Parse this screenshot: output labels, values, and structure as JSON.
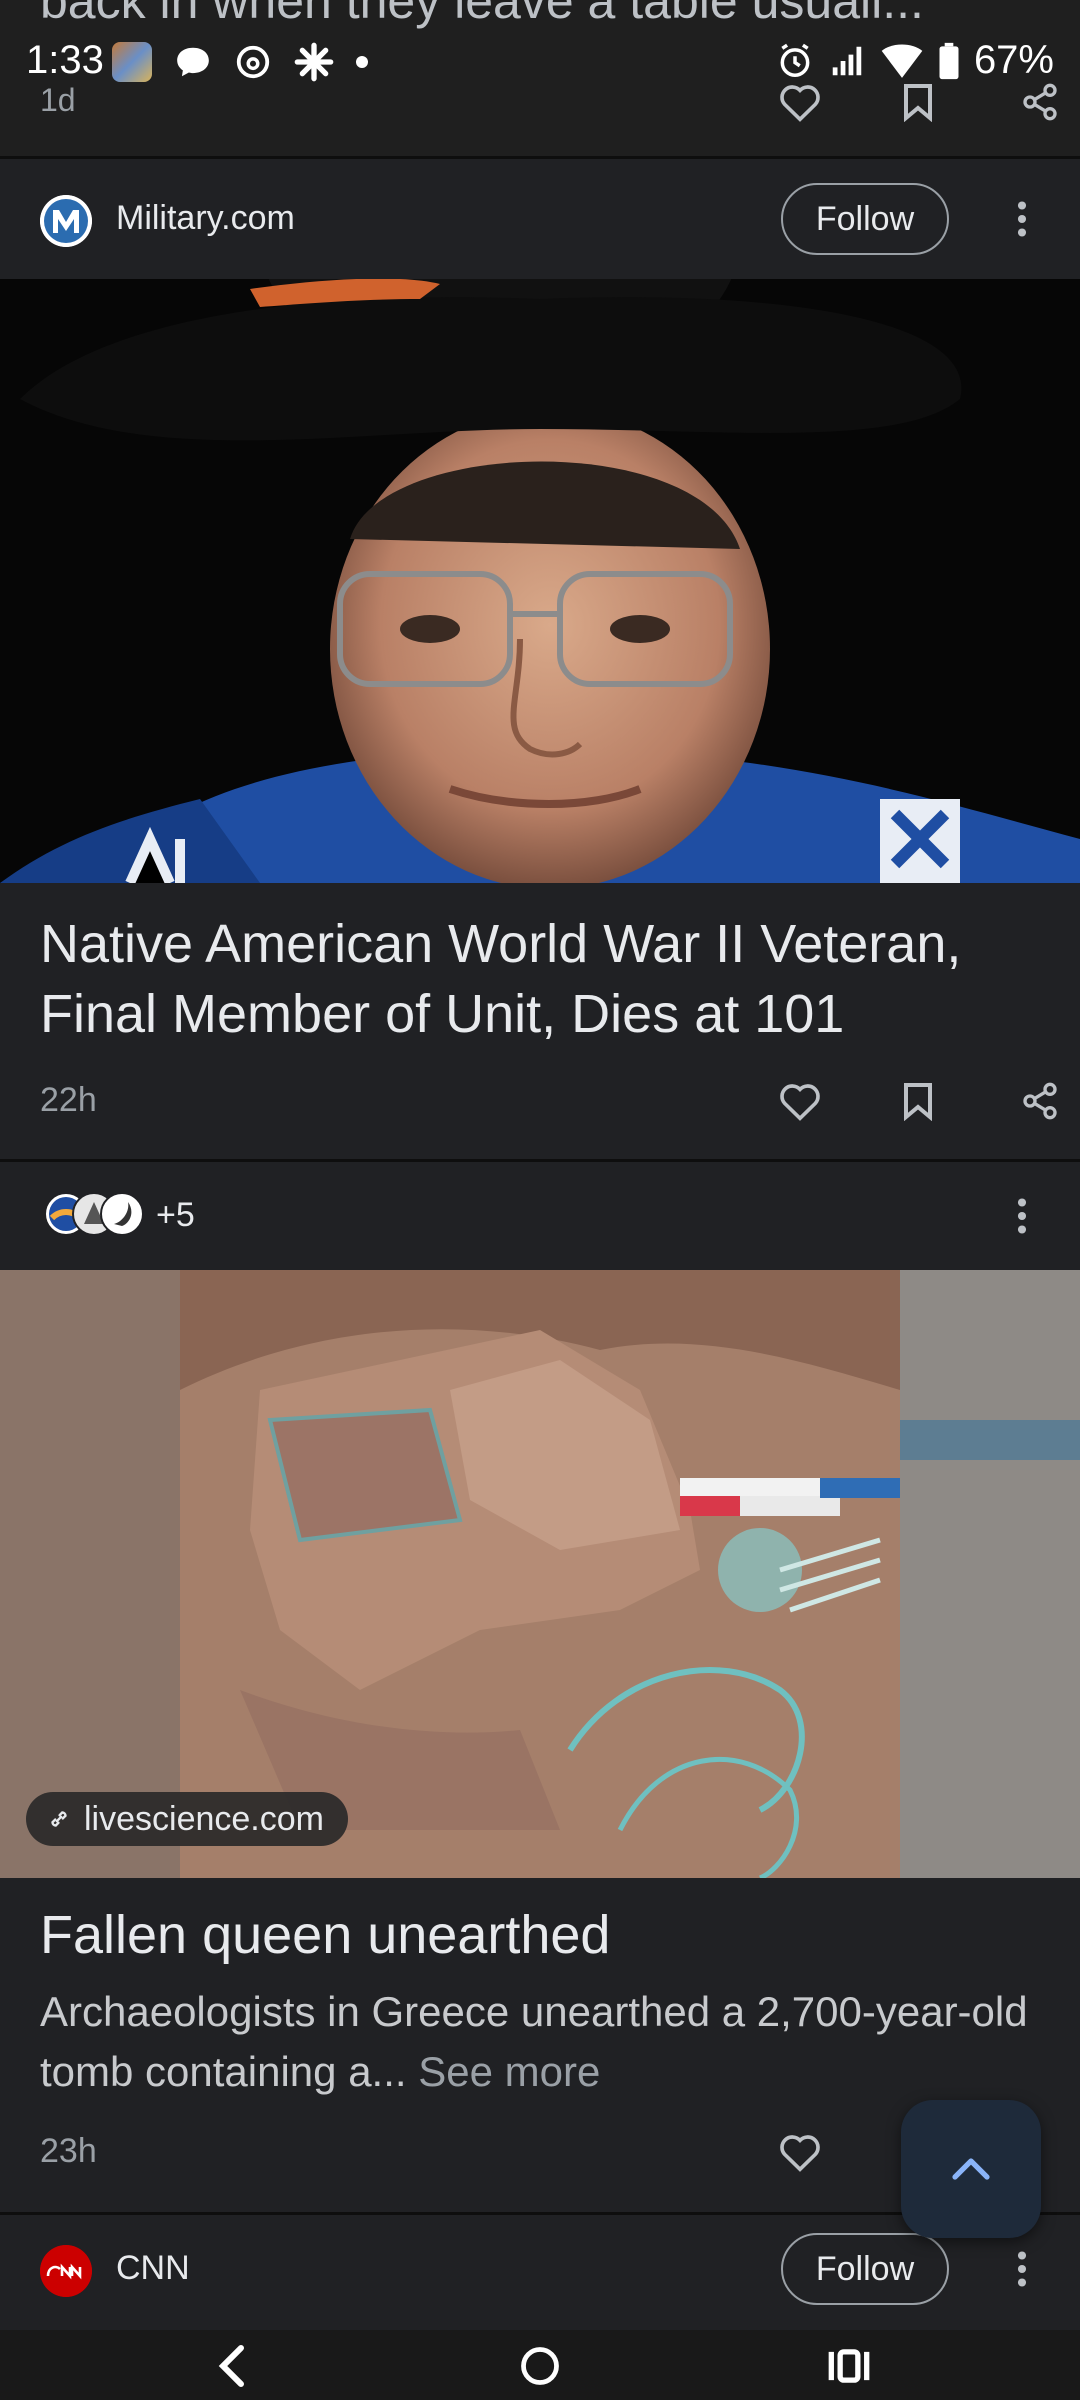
{
  "status_bar": {
    "time": "1:33",
    "battery": "67%"
  },
  "previous_card": {
    "title": "back in when they leave a table usuall...",
    "age": "1d"
  },
  "card1": {
    "source": "Military.com",
    "follow_label": "Follow",
    "headline": "Native American World War II Veteran, Final Member of Unit, Dies at 101",
    "age": "22h"
  },
  "card2": {
    "source_count": "+5",
    "link_domain": "livescience.com",
    "headline": "Fallen queen unearthed",
    "snippet": "Archaeologists in Greece unearthed a 2,700-year-old tomb containing a...",
    "see_more": "See more",
    "age": "23h"
  },
  "card3": {
    "source": "CNN",
    "follow_label": "Follow"
  },
  "icons": {
    "like": "heart-icon",
    "save": "bookmark-icon",
    "share": "share-icon",
    "more": "more-vert-icon",
    "scroll_top": "chevron-up-icon"
  },
  "colors": {
    "background": "#202124",
    "fab": "#1e2a3a",
    "fab_icon": "#8ab4f8"
  }
}
